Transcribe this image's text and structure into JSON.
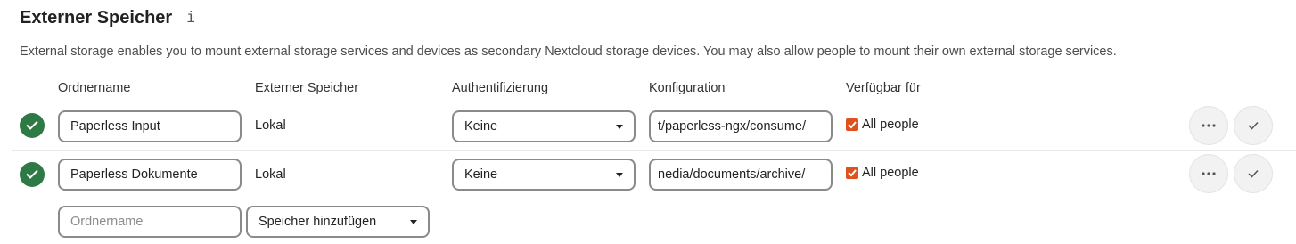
{
  "header": {
    "title": "Externer Speicher",
    "info_icon": "info-icon",
    "description": "External storage enables you to mount external storage services and devices as secondary Nextcloud storage devices. You may also allow people to mount their own external storage services."
  },
  "table": {
    "columns": [
      "Ordnername",
      "Externer Speicher",
      "Authentifizierung",
      "Konfiguration",
      "Verfügbar für"
    ],
    "rows": [
      {
        "folder_name": "Paperless Input",
        "backend": "Lokal",
        "auth": "Keine",
        "config": "t/paperless-ngx/consume/",
        "available_checked": true,
        "available_label": "All people"
      },
      {
        "folder_name": "Paperless Dokumente",
        "backend": "Lokal",
        "auth": "Keine",
        "config": "nedia/documents/archive/",
        "available_checked": true,
        "available_label": "All people"
      }
    ],
    "new_row": {
      "folder_placeholder": "Ordnername",
      "add_storage_label": "Speicher hinzufügen"
    }
  },
  "colors": {
    "status_ok": "#2d7a45",
    "checkbox": "#e0521d"
  }
}
